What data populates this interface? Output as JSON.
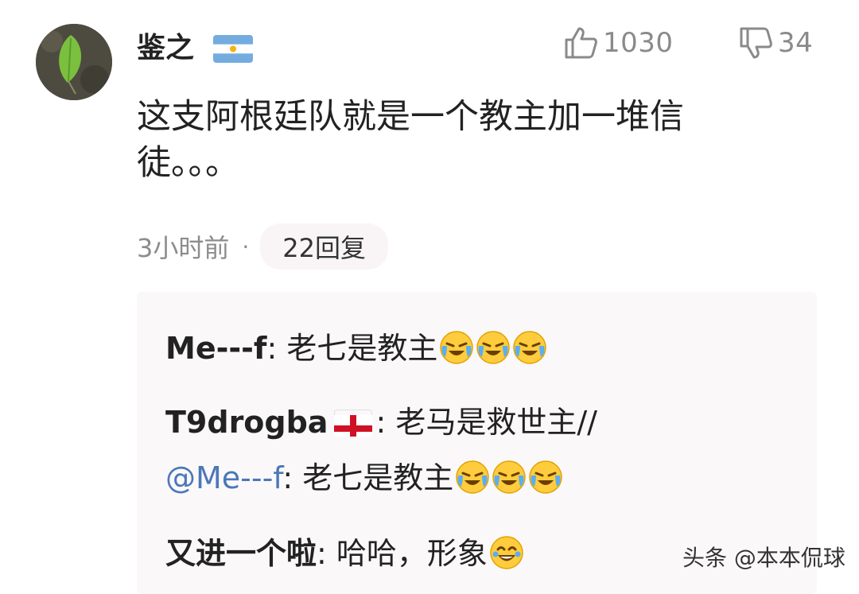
{
  "comment": {
    "username": "鉴之",
    "user_flag": "argentina-flag",
    "like_count": "1030",
    "dislike_count": "34",
    "text": "这支阿根廷队就是一个教主加一堆信徒。。。",
    "time": "3小时前",
    "separator": "·",
    "reply_button": "22回复"
  },
  "replies": [
    {
      "author": "Me---f",
      "colon": ":",
      "text": "老七是教主",
      "emojis": [
        "crying-laughing-emoji",
        "crying-laughing-emoji",
        "crying-laughing-emoji"
      ]
    },
    {
      "author": "T9drogba",
      "author_flag": "england-flag",
      "colon": ":",
      "text": "老马是救世主//",
      "mention": "@Me---f",
      "mention_text": "老七是教主",
      "emojis": [
        "crying-laughing-emoji",
        "crying-laughing-emoji",
        "crying-laughing-emoji"
      ]
    },
    {
      "author": "又进一个啦",
      "colon": ":",
      "text": "哈哈，形象",
      "emojis": [
        "laughing-tears-emoji"
      ]
    }
  ],
  "watermark": "头条 @本本侃球",
  "colors": {
    "mention": "#4a78b8",
    "muted": "#8a8a8a",
    "reply_bg": "#fbf8fa"
  }
}
